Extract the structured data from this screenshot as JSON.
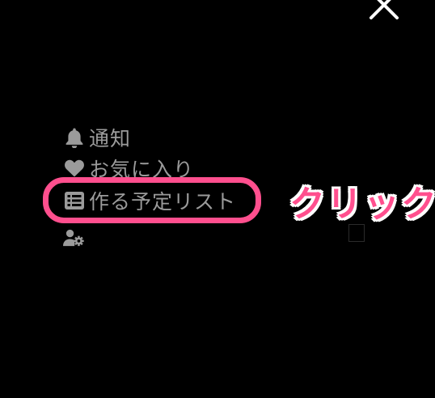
{
  "close": {
    "icon": "close-icon"
  },
  "menu": {
    "items": [
      {
        "icon": "bell-icon",
        "label": "通知"
      },
      {
        "icon": "heart-icon",
        "label": "お気に入り"
      },
      {
        "icon": "list-icon",
        "label": "作る予定リスト"
      },
      {
        "icon": "user-gear-icon",
        "label": ""
      }
    ]
  },
  "annotation": {
    "label": "クリック",
    "color": "#ff4f8e"
  }
}
